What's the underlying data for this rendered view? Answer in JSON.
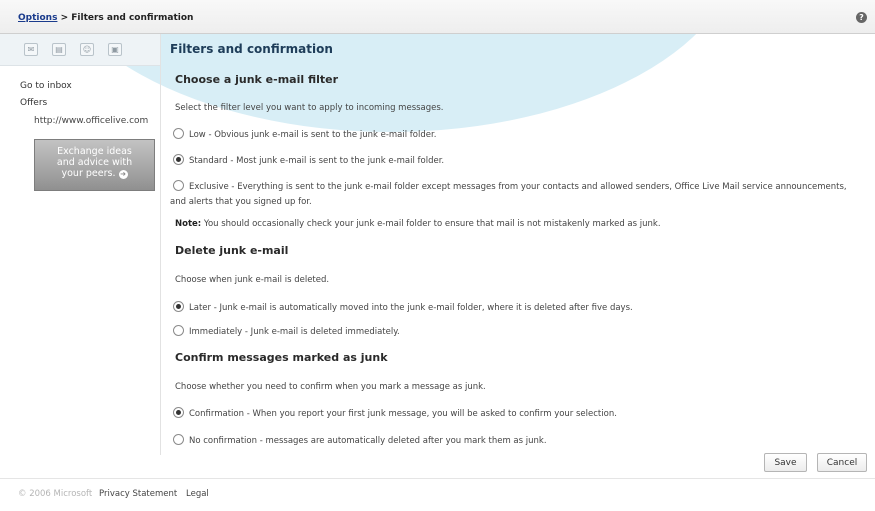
{
  "breadcrumb": {
    "root": "Options",
    "sep": ">",
    "current": "Filters and confirmation"
  },
  "sidebar": {
    "links": [
      "Go to inbox",
      "Offers"
    ],
    "url": "http://www.officelive.com",
    "promo": {
      "line1": "Exchange ideas",
      "line2": "and advice with",
      "line3": "your peers."
    }
  },
  "page": {
    "title": "Filters and confirmation"
  },
  "filter": {
    "heading": "Choose a junk e-mail filter",
    "desc": "Select the filter level you want to apply to incoming messages.",
    "options": [
      {
        "label": "Low - Obvious junk e-mail is sent to the junk e-mail folder.",
        "selected": false
      },
      {
        "label": "Standard - Most junk e-mail is sent to the junk e-mail folder.",
        "selected": true
      },
      {
        "label": "Exclusive - Everything is sent to the junk e-mail folder except messages from your contacts and allowed senders, Office Live Mail service announcements, and alerts that you signed up for.",
        "selected": false
      }
    ],
    "note_label": "Note:",
    "note_text": "You should occasionally check your junk e-mail folder to ensure that mail is not mistakenly marked as junk."
  },
  "delete": {
    "heading": "Delete junk e-mail",
    "desc": "Choose when junk e-mail is deleted.",
    "options": [
      {
        "label": "Later - Junk e-mail is automatically moved into the junk e-mail folder, where it is deleted after five days.",
        "selected": true
      },
      {
        "label": "Immediately - Junk e-mail is deleted immediately.",
        "selected": false
      }
    ]
  },
  "confirm": {
    "heading": "Confirm messages marked as junk",
    "desc": "Choose whether you need to confirm when you mark a message as junk.",
    "options": [
      {
        "label": "Confirmation - When you report your first junk message, you will be asked to confirm your selection.",
        "selected": true
      },
      {
        "label": "No confirmation - messages are automatically deleted after you mark them as junk.",
        "selected": false
      }
    ]
  },
  "buttons": {
    "save": "Save",
    "cancel": "Cancel"
  },
  "footer": {
    "copyright": "© 2006 Microsoft",
    "privacy": "Privacy Statement",
    "legal": "Legal"
  }
}
